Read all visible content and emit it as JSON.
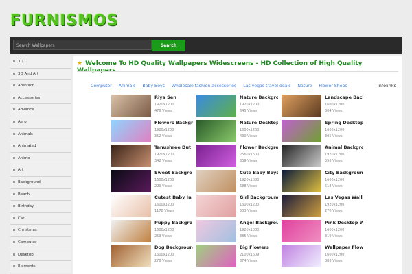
{
  "logo": {
    "text": "FURNISMOS"
  },
  "search": {
    "placeholder": "Search Wallpapers",
    "button": "Search"
  },
  "sidebar": {
    "items": [
      "3D",
      "3D And Art",
      "Abstract",
      "Accessories",
      "Advance",
      "Aero",
      "Animals",
      "Animated",
      "Anime",
      "Art",
      "Background",
      "Beach",
      "Birthday",
      "Car",
      "Christmas",
      "Computer",
      "Desktop",
      "Elements"
    ]
  },
  "main": {
    "welcome": "Welcome To HD Quality Wallpapers Widescreens - HD Collection of High Quality Wallpapers",
    "tags": [
      "Computer",
      "Animals",
      "Baby Boys",
      "Wholesale fashion accessories",
      "Las vegas travel deals",
      "Nature",
      "Flower Shops"
    ],
    "ad_label": "infolinks"
  },
  "wallpapers": [
    {
      "title": "Riya Sen",
      "res": "1920x1200",
      "views": "476 Views",
      "colors": [
        "#d9c2a8",
        "#7b5a45"
      ]
    },
    {
      "title": "Nature Backgro",
      "res": "1920x1200",
      "views": "645 Views",
      "colors": [
        "#3a8be0",
        "#5fb04a"
      ]
    },
    {
      "title": "Landscape Back",
      "res": "1600x1200",
      "views": "304 Views",
      "colors": [
        "#e0a060",
        "#5a3a20"
      ]
    },
    {
      "title": "Flowers Backgr",
      "res": "1920x1200",
      "views": "352 Views",
      "colors": [
        "#8fd4ff",
        "#e080c0"
      ]
    },
    {
      "title": "Nature Desktop",
      "res": "1600x1200",
      "views": "430 Views",
      "colors": [
        "#2a5a2a",
        "#8acb6a"
      ]
    },
    {
      "title": "Spring Desktop",
      "res": "1600x1200",
      "views": "305 Views",
      "colors": [
        "#c060d0",
        "#70a030"
      ]
    },
    {
      "title": "Tanushree Dut",
      "res": "1920x1200",
      "views": "342 Views",
      "colors": [
        "#3a2418",
        "#c89070"
      ]
    },
    {
      "title": "Flower Backgrou",
      "res": "2560x1600",
      "views": "359 Views",
      "colors": [
        "#7a2090",
        "#d060e0"
      ]
    },
    {
      "title": "Animal Backgro",
      "res": "1920x1200",
      "views": "558 Views",
      "colors": [
        "#222222",
        "#cccccc"
      ]
    },
    {
      "title": "Sweet Backgro",
      "res": "1600x1200",
      "views": "229 Views",
      "colors": [
        "#0a0a14",
        "#5a1a5a"
      ]
    },
    {
      "title": "Cute Baby Boys",
      "res": "1920x1080",
      "views": "688 Views",
      "colors": [
        "#e0d0c0",
        "#c09060"
      ]
    },
    {
      "title": "City Background",
      "res": "1600x1200",
      "views": "518 Views",
      "colors": [
        "#0a1a3a",
        "#e0c040"
      ]
    },
    {
      "title": "Cutest Baby In",
      "res": "1600x1200",
      "views": "1178 Views",
      "colors": [
        "#ffffff",
        "#e8c0a8"
      ]
    },
    {
      "title": "Girl Background",
      "res": "1600x1200",
      "views": "533 Views",
      "colors": [
        "#f5d5d5",
        "#e0a0a0"
      ]
    },
    {
      "title": "Las Vegas Wallpa",
      "res": "1920x1200",
      "views": "270 Views",
      "colors": [
        "#1a1a3a",
        "#d0a040"
      ]
    },
    {
      "title": "Puppy Backgro",
      "res": "1600x1200",
      "views": "253 Views",
      "colors": [
        "#f0f0f0",
        "#c08040"
      ]
    },
    {
      "title": "Angel Backgroun",
      "res": "1920x1080",
      "views": "385 Views",
      "colors": [
        "#f0c8e0",
        "#a0c0e0"
      ]
    },
    {
      "title": "Pink Desktop W",
      "res": "1600x1200",
      "views": "319 Views",
      "colors": [
        "#e040a0",
        "#f090c0"
      ]
    },
    {
      "title": "Dog Backgroun",
      "res": "1600x1200",
      "views": "276 Views",
      "colors": [
        "#a06030",
        "#f0e0c0"
      ]
    },
    {
      "title": "Big Flowers",
      "res": "2100x1609",
      "views": "374 Views",
      "colors": [
        "#a0d080",
        "#e060c0"
      ]
    },
    {
      "title": "Wallpaper Flow",
      "res": "1600x1200",
      "views": "388 Views",
      "colors": [
        "#c080e0",
        "#f0f0ff"
      ]
    }
  ]
}
